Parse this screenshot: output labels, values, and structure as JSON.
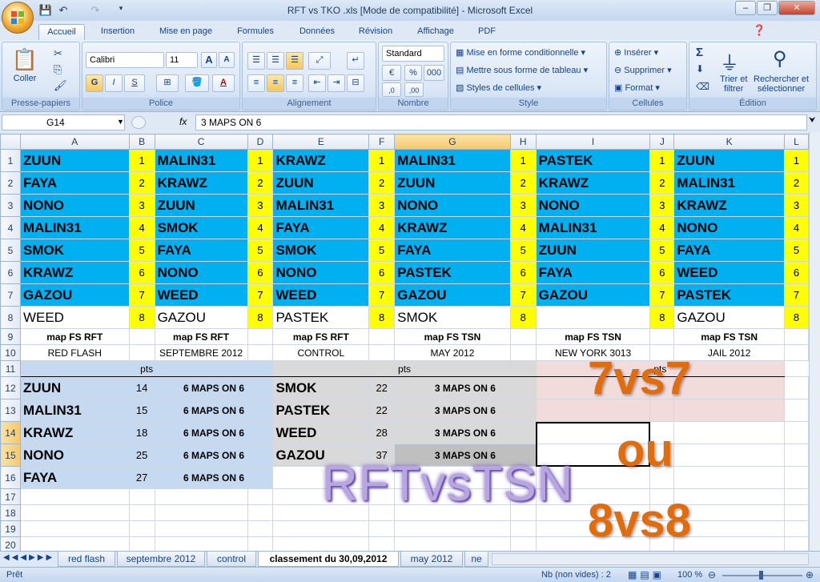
{
  "window": {
    "title": "RFT vs TKO .xls  [Mode de compatibilité] - Microsoft Excel",
    "minimize": "–",
    "maximize": "❐",
    "close": "✕"
  },
  "ribbon_tabs": [
    "Accueil",
    "Insertion",
    "Mise en page",
    "Formules",
    "Données",
    "Révision",
    "Affichage",
    "PDF"
  ],
  "ribbon": {
    "clipboard": {
      "label": "Presse-papiers",
      "paste": "Coller"
    },
    "font": {
      "label": "Police",
      "name": "Calibri",
      "size": "11",
      "bold": "G",
      "italic": "I",
      "underline": "S"
    },
    "alignment": {
      "label": "Alignement"
    },
    "number": {
      "label": "Nombre",
      "format": "Standard",
      "percent": "%",
      "thousands": "000"
    },
    "style": {
      "label": "Style",
      "conditional": "Mise en forme conditionnelle",
      "table": "Mettre sous forme de tableau",
      "cell_styles": "Styles de cellules"
    },
    "cells": {
      "label": "Cellules",
      "insert": "Insérer",
      "delete": "Supprimer",
      "format": "Format"
    },
    "edit": {
      "label": "Édition",
      "sum": "Σ",
      "sort_l1": "Trier et",
      "sort_l2": "filtrer",
      "find_l1": "Rechercher et",
      "find_l2": "sélectionner"
    }
  },
  "formula_bar": {
    "name_box": "G14",
    "fx": "fx",
    "value": "3 MAPS ON 6"
  },
  "columns": [
    "A",
    "B",
    "C",
    "D",
    "E",
    "F",
    "G",
    "H",
    "I",
    "J",
    "K",
    "L"
  ],
  "rows_1_8": [
    [
      "ZUUN",
      "1",
      "MALIN31",
      "1",
      "KRAWZ",
      "1",
      "MALIN31",
      "1",
      "PASTEK",
      "1",
      "ZUUN",
      "1"
    ],
    [
      "FAYA",
      "2",
      "KRAWZ",
      "2",
      "ZUUN",
      "2",
      "ZUUN",
      "2",
      "KRAWZ",
      "2",
      "MALIN31",
      "2"
    ],
    [
      "NONO",
      "3",
      "ZUUN",
      "3",
      "MALIN31",
      "3",
      "NONO",
      "3",
      "NONO",
      "3",
      "KRAWZ",
      "3"
    ],
    [
      "MALIN31",
      "4",
      "SMOK",
      "4",
      "FAYA",
      "4",
      "KRAWZ",
      "4",
      "MALIN31",
      "4",
      "NONO",
      "4"
    ],
    [
      "SMOK",
      "5",
      "FAYA",
      "5",
      "SMOK",
      "5",
      "FAYA",
      "5",
      "ZUUN",
      "5",
      "FAYA",
      "5"
    ],
    [
      "KRAWZ",
      "6",
      "NONO",
      "6",
      "NONO",
      "6",
      "PASTEK",
      "6",
      "FAYA",
      "6",
      "WEED",
      "6"
    ],
    [
      "GAZOU",
      "7",
      "WEED",
      "7",
      "WEED",
      "7",
      "GAZOU",
      "7",
      "GAZOU",
      "7",
      "PASTEK",
      "7"
    ],
    [
      "WEED",
      "8",
      "GAZOU",
      "8",
      "PASTEK",
      "8",
      "SMOK",
      "8",
      "",
      "8",
      "GAZOU",
      "8"
    ]
  ],
  "row9": [
    "map FS RFT",
    "",
    "map FS RFT",
    "",
    "map FS RFT",
    "",
    "map FS TSN",
    "",
    "map FS TSN",
    "",
    "map FS TSN",
    ""
  ],
  "row10": [
    "RED FLASH",
    "",
    "SEPTEMBRE 2012",
    "",
    "CONTROL",
    "",
    "MAY 2012",
    "",
    "NEW YORK 3013",
    "",
    "JAIL 2012",
    ""
  ],
  "pts_label": "pts",
  "left_scores": [
    {
      "name": "ZUUN",
      "pts": "14",
      "maps": "6 MAPS ON 6"
    },
    {
      "name": "MALIN31",
      "pts": "15",
      "maps": "6 MAPS ON 6"
    },
    {
      "name": "KRAWZ",
      "pts": "18",
      "maps": "6 MAPS ON 6"
    },
    {
      "name": "NONO",
      "pts": "25",
      "maps": "6 MAPS ON 6"
    },
    {
      "name": "FAYA",
      "pts": "27",
      "maps": "6 MAPS ON 6"
    }
  ],
  "mid_scores": [
    {
      "name": "SMOK",
      "pts": "22",
      "maps": "3 MAPS ON 6"
    },
    {
      "name": "PASTEK",
      "pts": "22",
      "maps": "3 MAPS ON 6"
    },
    {
      "name": "WEED",
      "pts": "28",
      "maps": "3 MAPS ON 6"
    },
    {
      "name": "GAZOU",
      "pts": "37",
      "maps": "3 MAPS ON 6"
    }
  ],
  "overlay": {
    "line1": "7vs7",
    "line2": "ou",
    "line3": "8vs8",
    "wordart": "RFTvsTSN"
  },
  "sheet_tabs": [
    "red flash",
    "septembre 2012",
    "control",
    "classement du 30,09,2012",
    "may 2012",
    "ne"
  ],
  "status": {
    "ready": "Prêt",
    "count": "Nb (non vides) : 2",
    "zoom": "100 %"
  },
  "colors": {
    "blue": "#00b0f0",
    "yellow": "#ffff00",
    "light_blue": "#c5d9f1",
    "gray": "#d9d9d9",
    "pink": "#f2dcdb",
    "orange": "#e36c0a"
  }
}
